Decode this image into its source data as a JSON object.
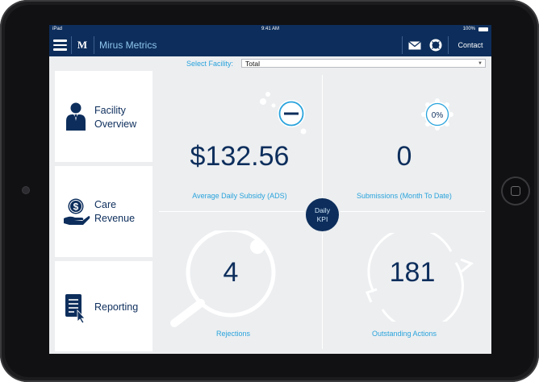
{
  "status_bar": {
    "device": "iPad",
    "time": "9:41 AM",
    "battery": "100%"
  },
  "nav": {
    "brand": "Mirus Metrics",
    "logo_text": "M",
    "contact_label": "Contact",
    "icons": [
      "menu-icon",
      "mail-icon",
      "lifebuoy-icon"
    ]
  },
  "filter": {
    "label": "Select Facility:",
    "value": "Total"
  },
  "sidebar": {
    "items": [
      {
        "label": "Facility Overview",
        "line1": "Facility",
        "line2": "Overview",
        "icon": "person-icon"
      },
      {
        "label": "Care Revenue",
        "line1": "Care",
        "line2": "Revenue",
        "icon": "money-hand-icon"
      },
      {
        "label": "Reporting",
        "line1": "Reporting",
        "line2": "",
        "icon": "report-icon"
      }
    ]
  },
  "kpis": {
    "ads": {
      "value": "$132.56",
      "label": "Average Daily Subsidy (ADS)",
      "icon": "minus-bubble-icon"
    },
    "submissions": {
      "value": "0",
      "label": "Submissions (Month To Date)",
      "badge": "0%",
      "icon": "percent-badge-icon"
    },
    "rejections": {
      "value": "4",
      "label": "Rejections",
      "icon": "magnifier-icon"
    },
    "outstanding": {
      "value": "181",
      "label": "Outstanding Actions",
      "icon": "refresh-cycle-icon"
    },
    "center_badge": {
      "line1": "Daily",
      "line2": "KPI"
    }
  },
  "colors": {
    "navy": "#0d2e5c",
    "accent": "#29a3dc",
    "panel": "#eceef0"
  }
}
